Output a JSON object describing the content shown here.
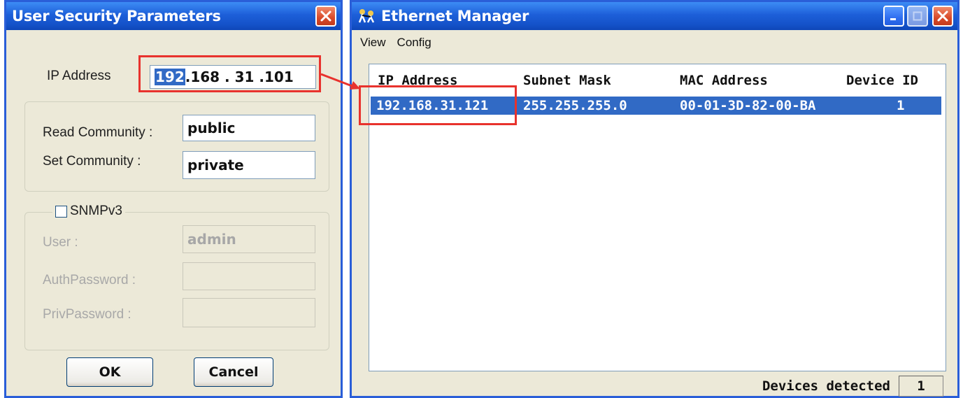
{
  "security_dialog": {
    "title": "User Security Parameters",
    "ip_label": "IP Address",
    "ip_value": {
      "part1": "192",
      "part2": ".168 . 31 .101"
    },
    "read_community_label": "Read Community :",
    "read_community_value": "public",
    "set_community_label": "Set Community :",
    "set_community_value": "private",
    "snmpv3_label": "SNMPv3",
    "snmpv3_checked": false,
    "user_label": "User :",
    "user_value": "admin",
    "auth_password_label": "AuthPassword :",
    "auth_password_value": "",
    "priv_password_label": "PrivPassword :",
    "priv_password_value": "",
    "ok_label": "OK",
    "cancel_label": "Cancel"
  },
  "ethernet_manager": {
    "title": "Ethernet Manager",
    "menu": [
      "View",
      "Config"
    ],
    "columns": [
      "IP Address",
      "Subnet Mask",
      "MAC Address",
      "Device ID"
    ],
    "rows": [
      {
        "ip": "192.168.31.121",
        "mask": "255.255.255.0",
        "mac": "00-01-3D-82-00-BA",
        "device_id": "1",
        "selected": true
      }
    ],
    "devices_detected_label": "Devices detected",
    "devices_detected_count": "1"
  },
  "colors": {
    "titlebar_blue": "#1d5fd9",
    "selection_blue": "#316ac5",
    "annotation_red": "#e8322d",
    "dialog_bg": "#ece9d8"
  },
  "icons": [
    "close-icon",
    "minimize-icon",
    "maximize-icon",
    "network-app-icon",
    "checkbox-icon"
  ]
}
